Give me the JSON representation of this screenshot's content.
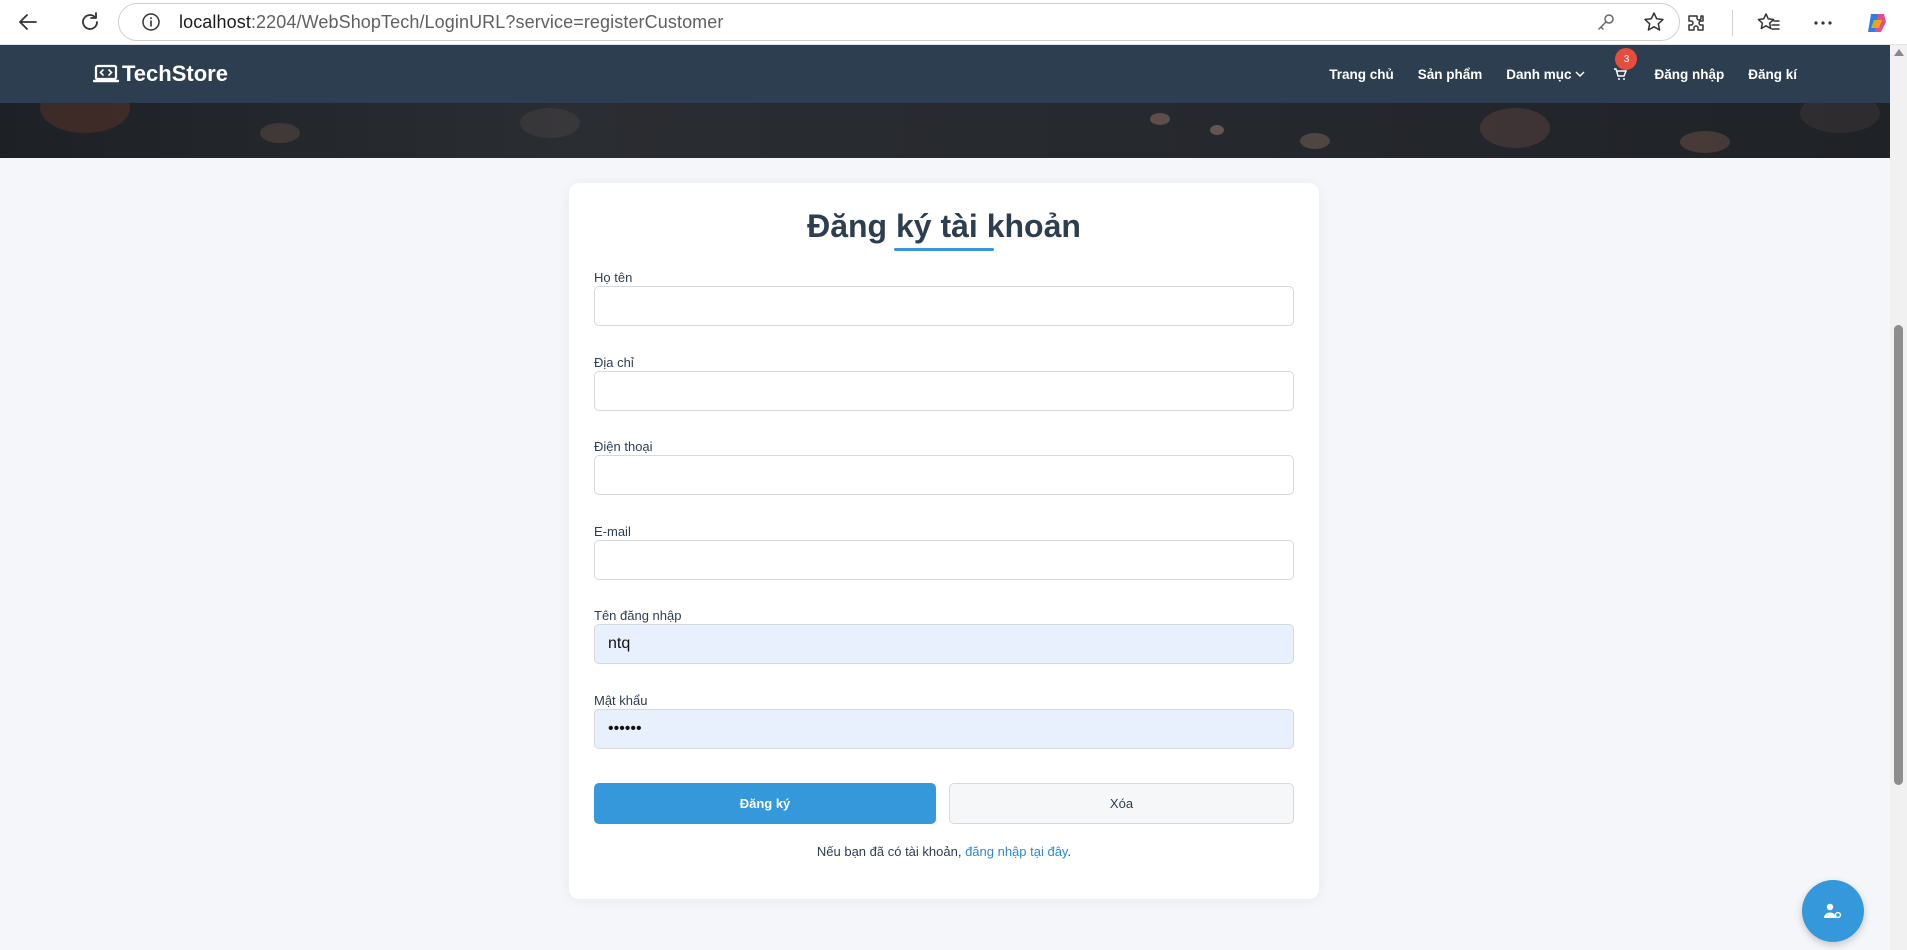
{
  "browser": {
    "url_host": "localhost",
    "url_rest": ":2204/WebShopTech/LoginURL?service=registerCustomer"
  },
  "header": {
    "logo_text": "TechStore",
    "menu": {
      "home": "Trang chủ",
      "products": "Sản phẩm",
      "categories": "Danh mục",
      "cart_count": "3",
      "login": "Đăng nhập",
      "register": "Đăng kí"
    }
  },
  "form": {
    "title": "Đăng ký tài khoản",
    "fields": {
      "fullname_label": "Họ tên",
      "fullname_value": "",
      "address_label": "Địa chỉ",
      "address_value": "",
      "phone_label": "Điện thoại",
      "phone_value": "",
      "email_label": "E-mail",
      "email_value": "",
      "username_label": "Tên đăng nhập",
      "username_value": "ntq",
      "password_label": "Mật khẩu",
      "password_value": "••••••"
    },
    "submit_label": "Đăng ký",
    "reset_label": "Xóa",
    "note_text": "Nếu bạn đã có tài khoản, ",
    "note_link": "đăng nhập tại đây",
    "note_end": "."
  },
  "colors": {
    "header_bg": "#2c3e50",
    "accent": "#3498db",
    "badge": "#e74c3c"
  }
}
